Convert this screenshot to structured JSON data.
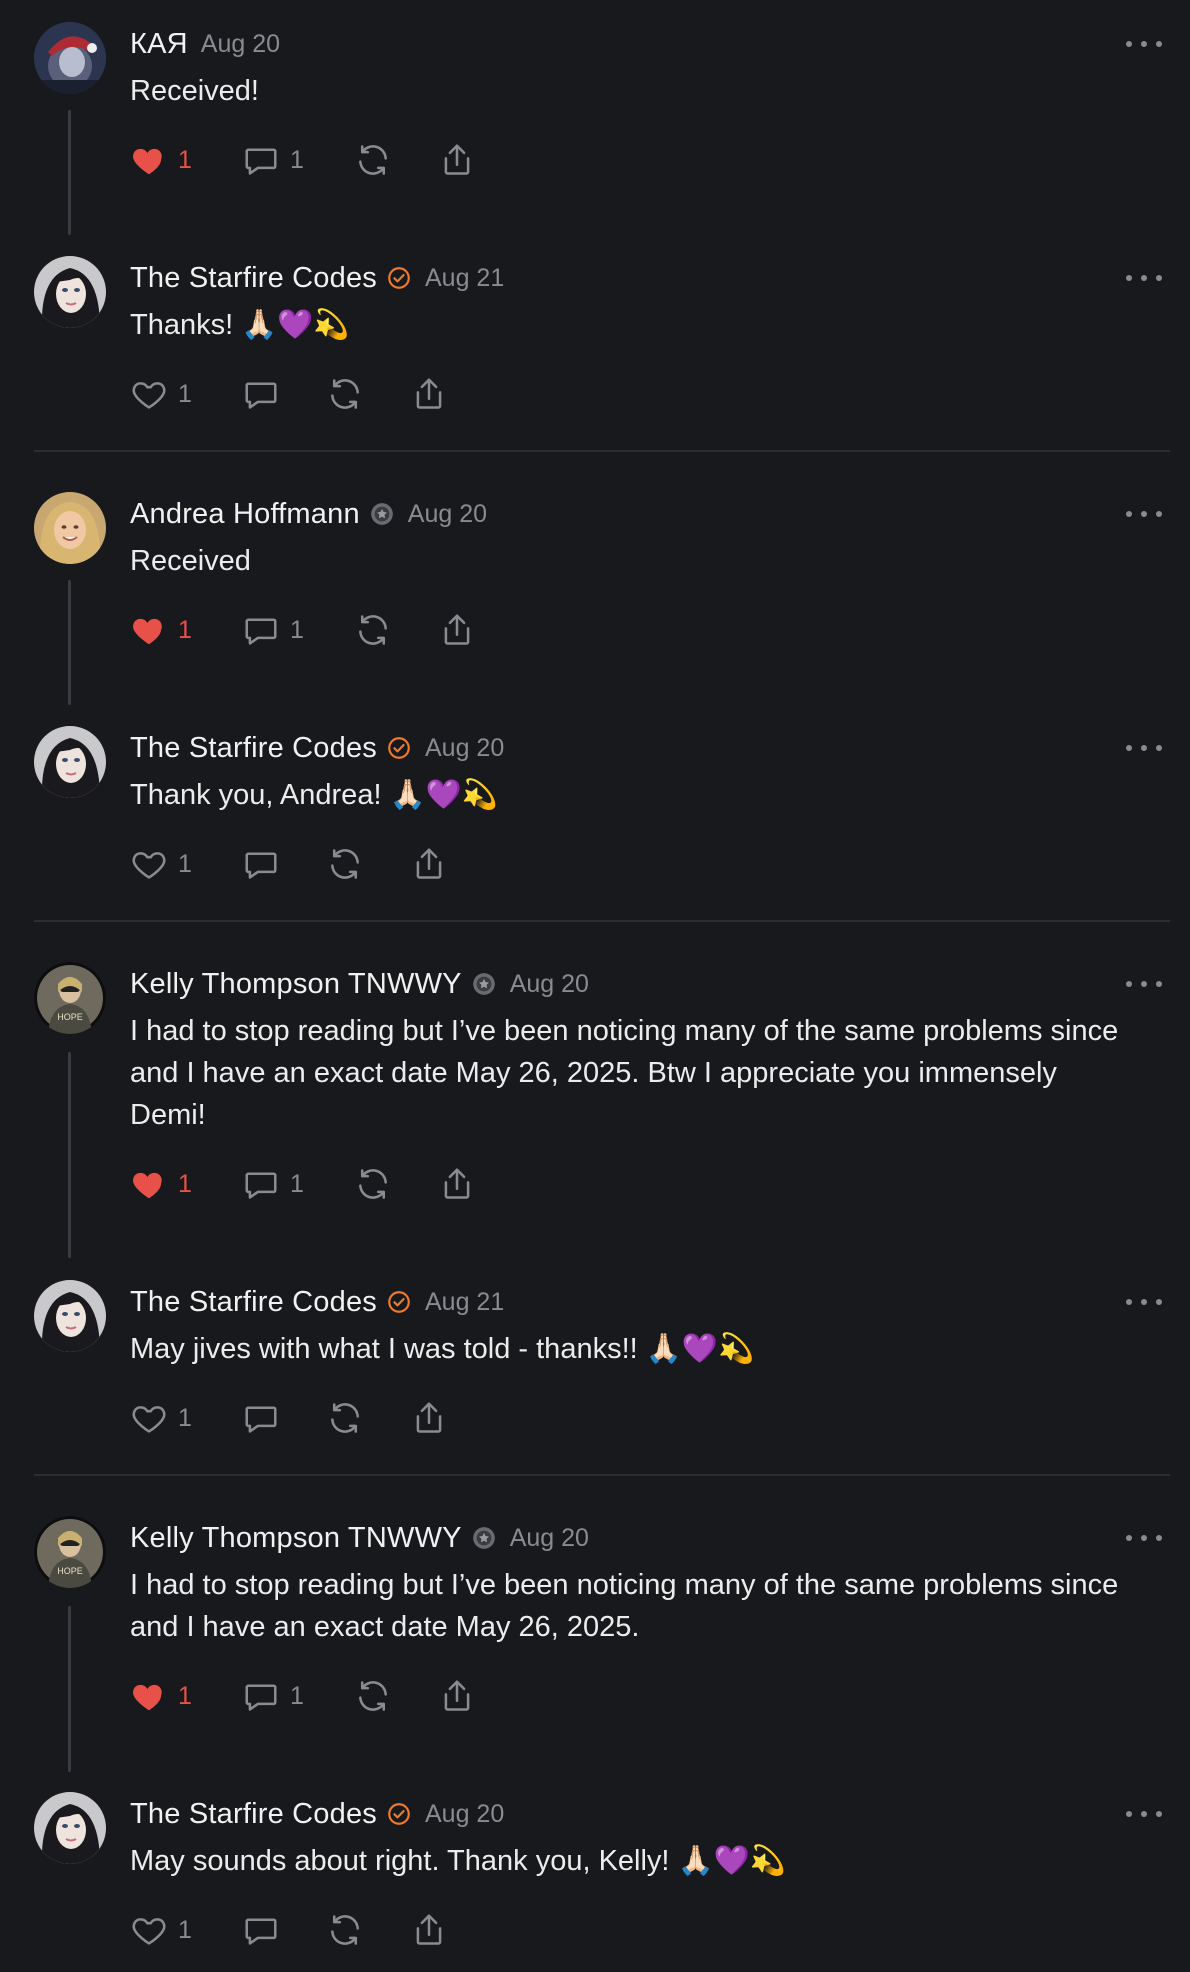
{
  "colors": {
    "background": "#18191c",
    "like_red": "#e8504a",
    "verified_orange": "#f07a2c",
    "muted": "#8a8b90"
  },
  "comments": [
    {
      "author": "КАЯ",
      "badge": "none",
      "date": "Aug 20",
      "text": "Received!",
      "liked": true,
      "likes": "1",
      "replies": "1",
      "avatar": "avatar-kaya"
    },
    {
      "author": "The Starfire Codes",
      "badge": "verified-check-icon",
      "date": "Aug 21",
      "text": "Thanks! 🙏🏻💜💫",
      "liked": false,
      "likes": "1",
      "replies": "",
      "avatar": "avatar-starfire"
    },
    {
      "author": "Andrea Hoffmann",
      "badge": "subscriber-star-icon",
      "date": "Aug 20",
      "text": "Received",
      "liked": true,
      "likes": "1",
      "replies": "1",
      "avatar": "avatar-andrea"
    },
    {
      "author": "The Starfire Codes",
      "badge": "verified-check-icon",
      "date": "Aug 20",
      "text": "Thank you, Andrea! 🙏🏻💜💫",
      "liked": false,
      "likes": "1",
      "replies": "",
      "avatar": "avatar-starfire"
    },
    {
      "author": "Kelly Thompson TNWWY",
      "badge": "subscriber-star-icon",
      "date": "Aug 20",
      "text": "I had to stop reading but I’ve been noticing many of the same problems since and I have an exact date May 26, 2025. Btw I appreciate you immensely Demi!",
      "liked": true,
      "likes": "1",
      "replies": "1",
      "avatar": "avatar-kelly"
    },
    {
      "author": "The Starfire Codes",
      "badge": "verified-check-icon",
      "date": "Aug 21",
      "text": "May jives with what I was told - thanks!! 🙏🏻💜💫",
      "liked": false,
      "likes": "1",
      "replies": "",
      "avatar": "avatar-starfire"
    },
    {
      "author": "Kelly Thompson TNWWY",
      "badge": "subscriber-star-icon",
      "date": "Aug 20",
      "text": "I had to stop reading but I’ve been noticing many of the same problems since and I have an exact date May 26, 2025.",
      "liked": true,
      "likes": "1",
      "replies": "1",
      "avatar": "avatar-kelly"
    },
    {
      "author": "The Starfire Codes",
      "badge": "verified-check-icon",
      "date": "Aug 20",
      "text": "May sounds about right. Thank you, Kelly! 🙏🏻💜💫",
      "liked": false,
      "likes": "1",
      "replies": "",
      "avatar": "avatar-starfire"
    }
  ]
}
